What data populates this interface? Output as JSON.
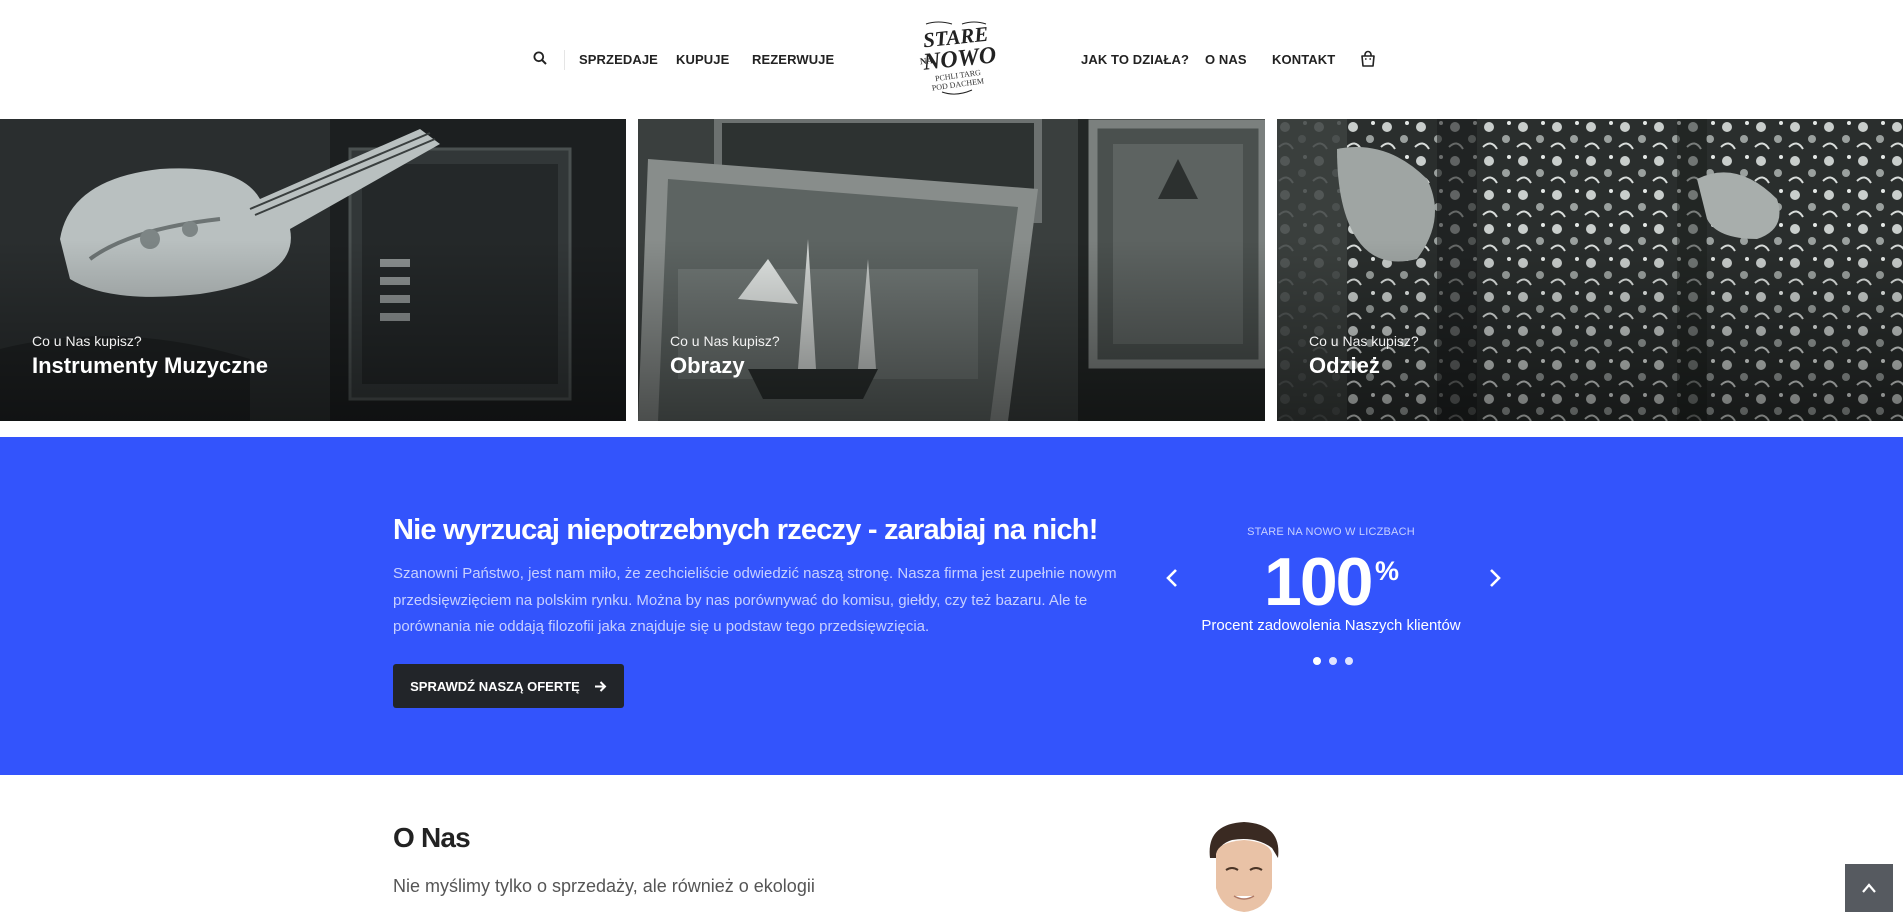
{
  "nav": {
    "left_links": [
      "SPRZEDAJE",
      "KUPUJE",
      "REZERWUJE"
    ],
    "right_links": [
      "JAK TO DZIAŁA?",
      "O NAS",
      "KONTAKT"
    ],
    "logo_text": [
      "STARE",
      "NA",
      "NOWO",
      "PCHLI TARG",
      "POD DACHEM"
    ],
    "search_icon": "search-icon",
    "bag_icon": "shopping-bag-icon"
  },
  "tiles": [
    {
      "kicker": "Co u Nas kupisz?",
      "title": "Instrumenty Muzyczne"
    },
    {
      "kicker": "Co u Nas kupisz?",
      "title": "Obrazy"
    },
    {
      "kicker": "Co u Nas kupisz?",
      "title": "Odzież"
    }
  ],
  "band": {
    "heading": "Nie wyrzucaj niepotrzebnych rzeczy - zarabiaj na nich!",
    "text": "Szanowni Państwo, jest nam miło, że zechcieliście odwiedzić naszą stronę. Nasza firma jest zupełnie nowym przedsięwzięciem na polskim rynku. Można by nas porównywać do komisu, giełdy, czy też bazaru. Ale te porównania nie oddają filozofii jaka znajduje się u podstaw tego przedsięwzięcia.",
    "cta": "SPRAWDŹ NASZĄ OFERTĘ",
    "stats_kicker": "STARE NA NOWO W LICZBACH",
    "stats_number": "100",
    "stats_unit": "%",
    "stats_label": "Procent zadowolenia Naszych klientów",
    "slides_total": 3,
    "slide_active": 1
  },
  "about": {
    "title": "O Nas",
    "subtitle": "Nie myślimy tylko o sprzedaży, ale również o ekologii"
  },
  "colors": {
    "band": "#3354fc",
    "cta": "#222529",
    "back_to_top": "#565a60"
  }
}
